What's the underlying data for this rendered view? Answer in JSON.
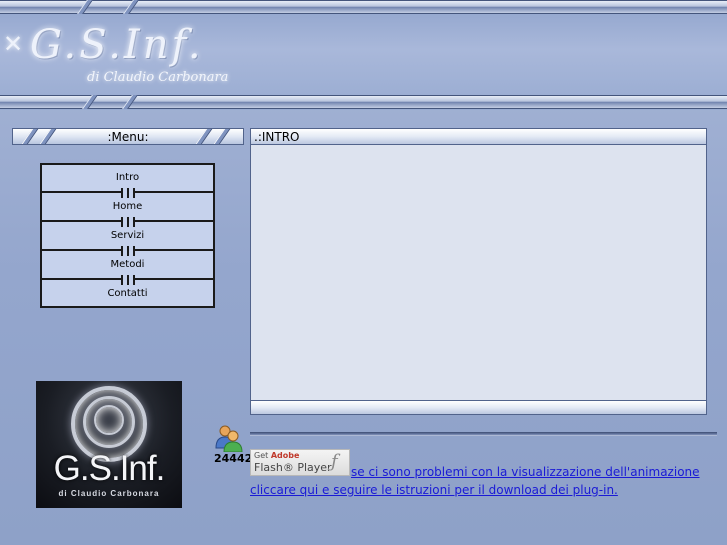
{
  "header": {
    "title": "G.S.Inf.",
    "subtitle": "di Claudio Carbonara"
  },
  "menu": {
    "heading": ":Menu:",
    "items": [
      {
        "label": "Intro"
      },
      {
        "label": "Home"
      },
      {
        "label": "Servizi"
      },
      {
        "label": "Metodi"
      },
      {
        "label": "Contatti"
      }
    ]
  },
  "logo_badge": {
    "title": "G.S.Inf.",
    "subtitle": "di Claudio Carbonara"
  },
  "counter": {
    "value": "24442",
    "icon": "users-icon"
  },
  "intro": {
    "heading": ".:INTRO"
  },
  "flash": {
    "get": "Get",
    "adobe": "Adobe",
    "player": "Flash® Player",
    "icon": "flash-icon"
  },
  "links": {
    "problem_text": "se ci sono problemi con la visualizzazione dell'animazione",
    "instructions_text": "cliccare qui e seguire le istruzioni per il download dei plug-in."
  },
  "colors": {
    "background": "#94a6cd",
    "panel": "#dde3ef",
    "menu_bg": "#c6d2ec",
    "link": "#1a1ad6"
  }
}
